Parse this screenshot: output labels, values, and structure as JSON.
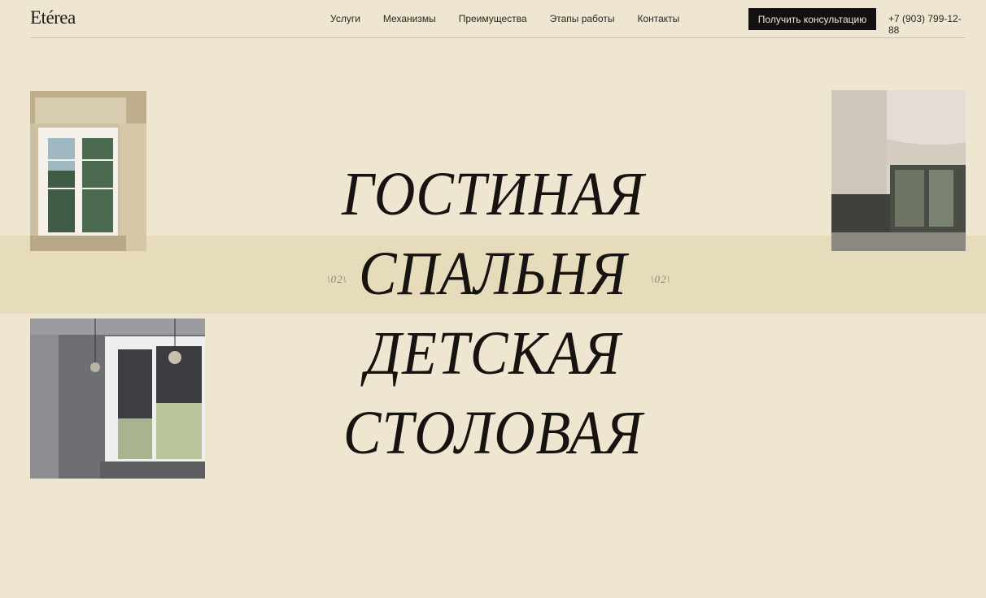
{
  "header": {
    "logo": "Etérea",
    "nav": [
      "Услуги",
      "Механизмы",
      "Преимущества",
      "Этапы работы",
      "Контакты"
    ],
    "cta_label": "Получить консультацию",
    "phone": "+7 (903) 799-12-88"
  },
  "hero": {
    "rooms": [
      "ГОСТИНАЯ",
      "СПАЛЬНЯ",
      "ДЕТСКАЯ",
      "СТОЛОВАЯ"
    ],
    "counter_left": "\\02\\",
    "counter_right": "\\02\\"
  },
  "colors": {
    "background": "#efe6d2",
    "band": "#e6dcbc",
    "button": "#131110"
  }
}
